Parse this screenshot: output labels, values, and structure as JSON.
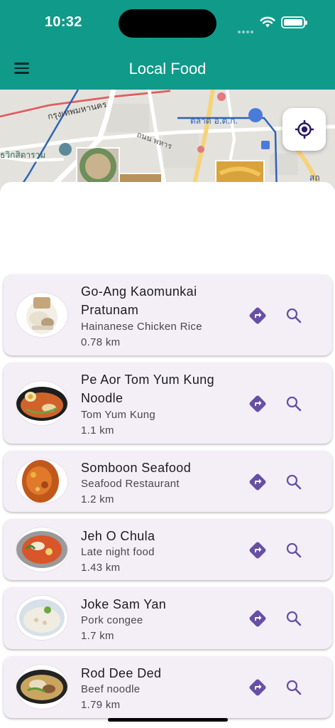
{
  "status_bar": {
    "time": "10:32"
  },
  "app_bar": {
    "title": "Local Food",
    "menu_icon": "hamburger-menu-icon"
  },
  "map": {
    "labels": [
      "กรุงเทพมหานคร",
      "ถนน พหาร",
      "ตลาด อ.ต.ก.",
      "ธวิกสิตาราม",
      "สถานี",
      "สถ"
    ],
    "locate_icon": "my-location-icon"
  },
  "restaurants": [
    {
      "name": "Go-Ang Kaomunkai Pratunam",
      "category": "Hainanese Chicken Rice",
      "distance": "0.78 km"
    },
    {
      "name": "Pe Aor Tom Yum Kung Noodle",
      "category": "Tom Yum Kung",
      "distance": "1.1 km"
    },
    {
      "name": "Somboon Seafood",
      "category": "Seafood Restaurant",
      "distance": "1.2 km"
    },
    {
      "name": "Jeh O Chula",
      "category": "Late night food",
      "distance": "1.43 km"
    },
    {
      "name": "Joke Sam Yan",
      "category": "Pork congee",
      "distance": "1.7 km"
    },
    {
      "name": "Rod Dee Ded",
      "category": "Beef noodle",
      "distance": "1.79 km"
    }
  ],
  "colors": {
    "primary": "#109a8a",
    "card": "#f4eff7",
    "icon": "#6750a4"
  }
}
